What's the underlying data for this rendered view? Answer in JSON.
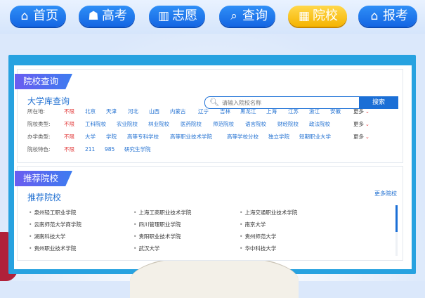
{
  "nav": [
    {
      "label": "首页",
      "icon": "home-icon",
      "glyph": "⌂"
    },
    {
      "label": "高考",
      "icon": "graduation-cap-icon",
      "glyph": "☗"
    },
    {
      "label": "志愿",
      "icon": "book-icon",
      "glyph": "▥"
    },
    {
      "label": "查询",
      "icon": "search-icon",
      "glyph": "⌕"
    },
    {
      "label": "院校",
      "icon": "building-icon",
      "glyph": "▦"
    },
    {
      "label": "报考",
      "icon": "school-icon",
      "glyph": "⌂"
    }
  ],
  "query": {
    "header": "院校查询",
    "subtitle": "大学库查询",
    "search_placeholder": "请输入院校名称",
    "search_button": "搜索",
    "filters": [
      {
        "label": "所在地:",
        "options": [
          "不限",
          "北京",
          "天津",
          "河北",
          "山西",
          "内蒙古",
          "辽宁",
          "吉林",
          "黑龙江",
          "上海",
          "江苏",
          "浙江",
          "安徽"
        ],
        "more": "更多"
      },
      {
        "label": "院校类型:",
        "options": [
          "不限",
          "工科院校",
          "农业院校",
          "林业院校",
          "医药院校",
          "师范院校",
          "语言院校",
          "财经院校",
          "政法院校"
        ],
        "more": "更多"
      },
      {
        "label": "办学类型:",
        "options": [
          "不限",
          "大学",
          "学院",
          "高等专科学校",
          "高等职业技术学院",
          "高等学校分校",
          "独立学院",
          "短期职业大学"
        ],
        "more": "更多"
      },
      {
        "label": "院校特色:",
        "options": [
          "不限",
          "211",
          "985",
          "研究生学院"
        ],
        "more": ""
      }
    ]
  },
  "recommend": {
    "header": "推荐院校",
    "subtitle": "推荐院校",
    "more_link": "更多院校",
    "schools": [
      [
        "泉州轻工职业学院",
        "上海工商职业技术学院",
        "上海交通职业技术学院"
      ],
      [
        "云南师范大学商学院",
        "四川管理职业学院",
        "南京大学"
      ],
      [
        "湖南科技大学",
        "贵阳职业技术学院",
        "贵州师范大学"
      ],
      [
        "贵州职业技术学院",
        "武汉大学",
        "华中科技大学"
      ]
    ]
  }
}
